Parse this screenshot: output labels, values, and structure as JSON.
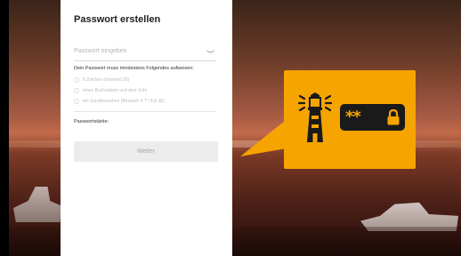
{
  "form": {
    "title": "Passwort erstellen",
    "password_placeholder": "Passwort eingeben",
    "requirements_heading": "Dein Passwort muss mindestens Folgendes aufweisen:",
    "requirements": [
      "8 Zeichen (maximal 20)",
      "einen Buchstaben und eine Zahl",
      "ein Sonderzeichen (Beispiel: # ? ! $ & @)"
    ],
    "strength_label": "Passwortstärke:",
    "continue_label": "Weiter"
  },
  "illustration": {
    "masked_password": "**",
    "icons": [
      "lighthouse-icon",
      "lock-icon",
      "eye-icon"
    ],
    "accent_color": "#f6a400"
  }
}
